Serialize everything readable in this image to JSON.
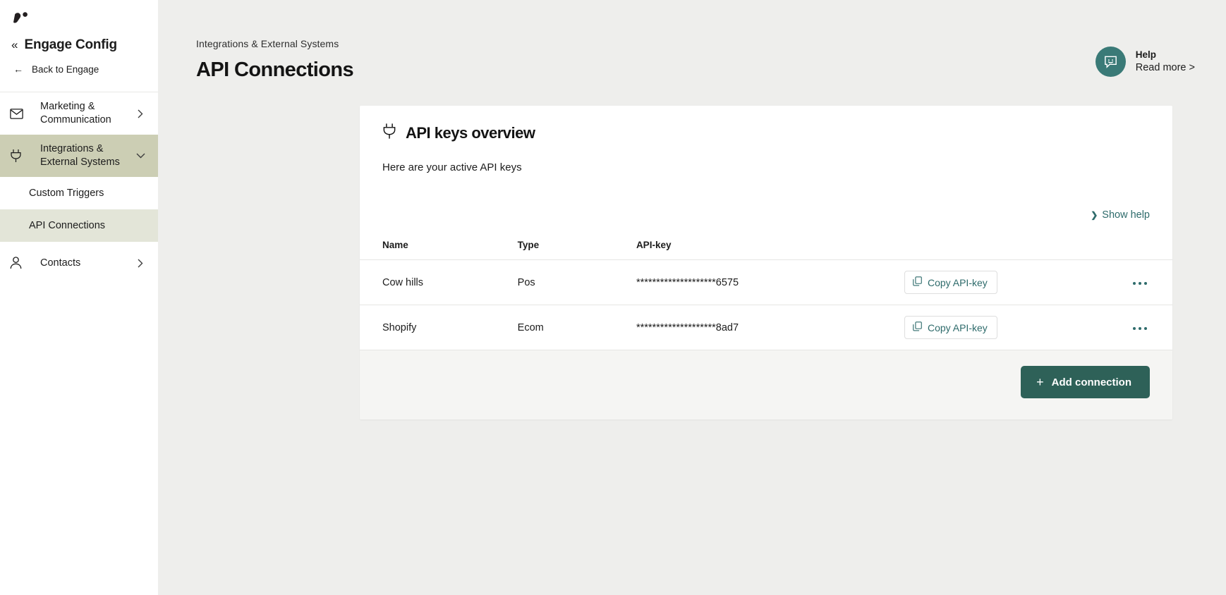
{
  "colors": {
    "page_bg": "#eeeeec",
    "sidebar_bg": "#ffffff",
    "nav_active_parent": "#ccceb4",
    "nav_active_sub": "#e3e5d8",
    "accent_teal": "#2e6b6b",
    "button_teal": "#2e6158",
    "help_circle_teal": "#3a7a77",
    "card_footer_bg": "#f5f5f3"
  },
  "sidebar": {
    "logo_icon": "vita-mojo-logo-mark",
    "collapse_icon": "«",
    "title": "Engage Config",
    "back": {
      "icon": "arrow-left-icon",
      "label": "Back to Engage"
    },
    "items": [
      {
        "label": "Marketing & Communication",
        "icon": "envelope-icon",
        "chevron": "chevron-right-icon",
        "active": false
      },
      {
        "label": "Integrations & External Systems",
        "icon": "plug-icon",
        "chevron": "chevron-down-icon",
        "active": true
      }
    ],
    "sub_items": [
      {
        "label": "Custom Triggers",
        "active": false
      },
      {
        "label": "API Connections",
        "active": true
      }
    ],
    "items_after": [
      {
        "label": "Contacts",
        "icon": "user-icon",
        "chevron": "chevron-right-icon",
        "active": false
      }
    ]
  },
  "header": {
    "breadcrumb": "Integrations & External Systems",
    "title": "API Connections",
    "help": {
      "icon": "chat-smiley-icon",
      "title": "Help",
      "subtitle": "Read more >"
    }
  },
  "card": {
    "icon": "plug-icon",
    "title": "API keys overview",
    "subtitle": "Here are your active API keys",
    "show_help": {
      "chevron": "❯",
      "label": "Show help"
    },
    "table": {
      "columns": [
        "Name",
        "Type",
        "API-key"
      ],
      "rows": [
        {
          "name": "Cow hills",
          "type": "Pos",
          "key": "********************6575",
          "copy_label": "Copy API-key",
          "copy_icon": "copy-icon",
          "menu_icon": "ellipsis-icon"
        },
        {
          "name": "Shopify",
          "type": "Ecom",
          "key": "********************8ad7",
          "copy_label": "Copy API-key",
          "copy_icon": "copy-icon",
          "menu_icon": "ellipsis-icon"
        }
      ]
    },
    "footer": {
      "add_icon": "plus-icon",
      "add_label": "Add connection"
    }
  }
}
